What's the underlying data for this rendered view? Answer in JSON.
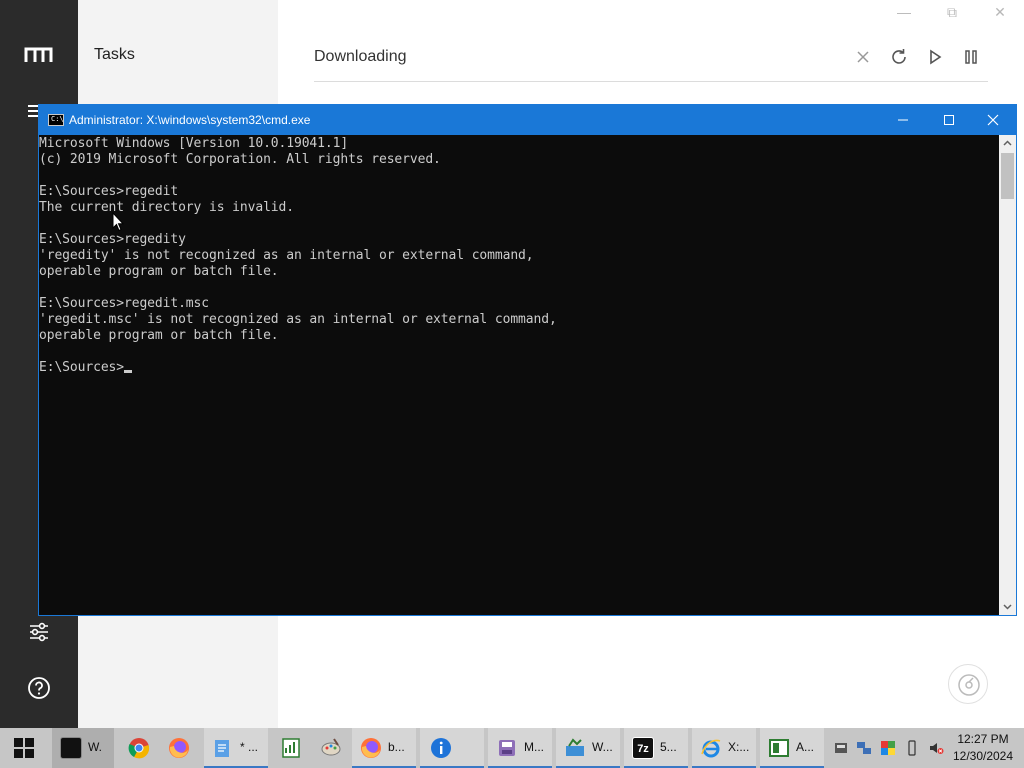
{
  "background_app": {
    "panel_title": "Tasks",
    "downloading_title": "Downloading"
  },
  "cmd": {
    "title": "Administrator: X:\\windows\\system32\\cmd.exe",
    "lines": [
      "Microsoft Windows [Version 10.0.19041.1]",
      "(c) 2019 Microsoft Corporation. All rights reserved.",
      "",
      "E:\\Sources>regedit",
      "The current directory is invalid.",
      "",
      "E:\\Sources>regedity",
      "'regedity' is not recognized as an internal or external command,",
      "operable program or batch file.",
      "",
      "E:\\Sources>regedit.msc",
      "'regedit.msc' is not recognized as an internal or external command,",
      "operable program or batch file.",
      "",
      "E:\\Sources>"
    ],
    "icon_text": "C:\\"
  },
  "taskbar": {
    "items": [
      {
        "label": "W.",
        "icon": "cmd-icon"
      },
      {
        "label": "",
        "icon": "chrome-icon"
      },
      {
        "label": "",
        "icon": "firefox-icon"
      },
      {
        "label": "* ...",
        "icon": "notepad-icon"
      },
      {
        "label": "",
        "icon": "chart-app-icon"
      },
      {
        "label": "",
        "icon": "paint-icon"
      },
      {
        "label": "b...",
        "icon": "firefox-icon"
      },
      {
        "label": "",
        "icon": "info-icon"
      },
      {
        "label": "M...",
        "icon": "disk-icon"
      },
      {
        "label": "W...",
        "icon": "installer-icon"
      },
      {
        "label": "5...",
        "icon": "7zip-icon"
      },
      {
        "label": "X:...",
        "icon": "ie-icon"
      },
      {
        "label": "A...",
        "icon": "app-icon"
      }
    ],
    "clock_time": "12:27 PM",
    "clock_date": "12/30/2024",
    "sevenzip_text": "7z"
  },
  "colors": {
    "cmd_titlebar": "#1a78d7",
    "cmd_bg": "#0c0c0c",
    "cmd_text": "#cccccc",
    "taskbar": "#c6c6c6"
  }
}
